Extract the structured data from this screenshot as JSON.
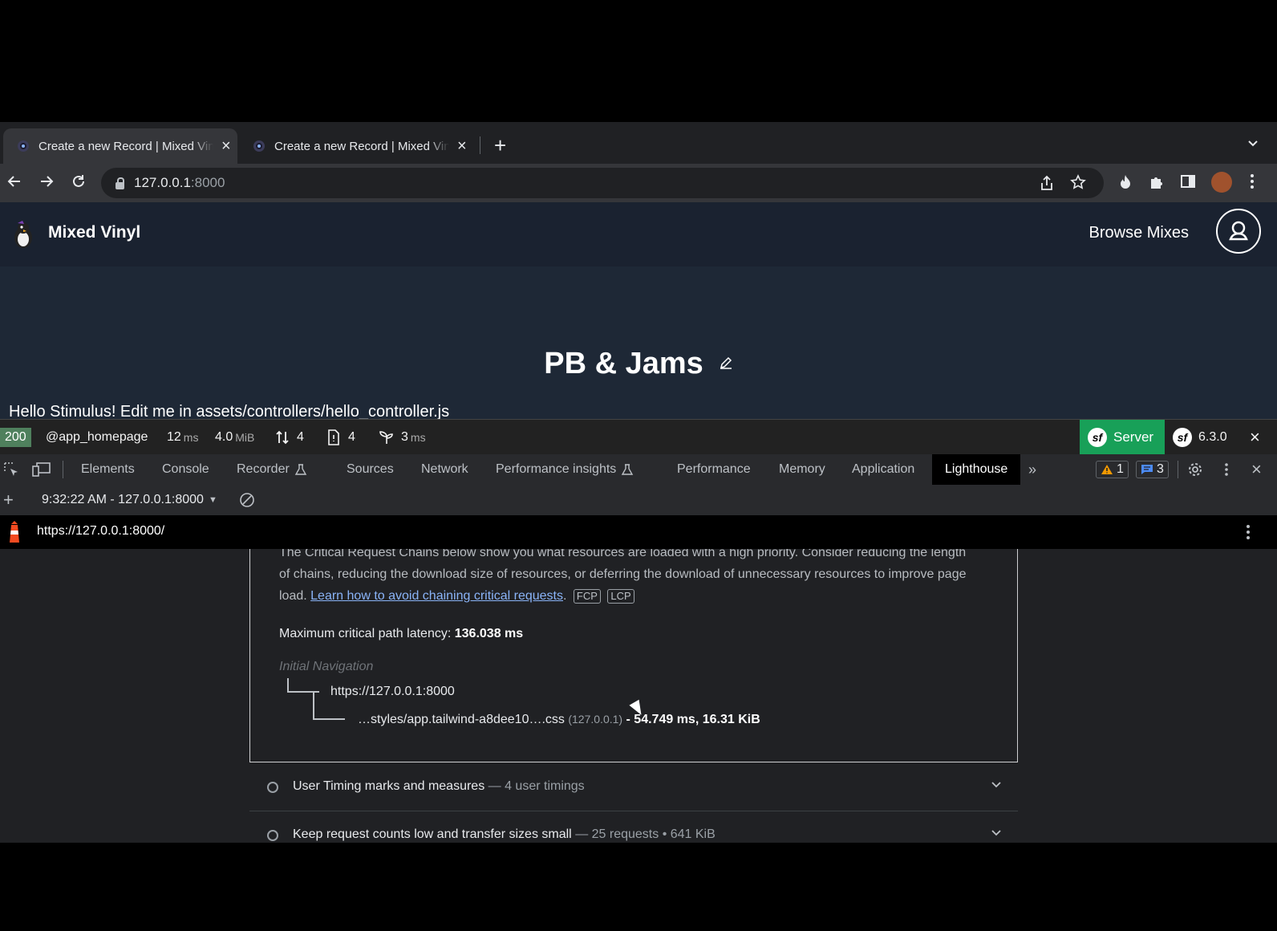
{
  "browser": {
    "tabs": [
      {
        "title": "Create a new Record | Mixed Vinyl",
        "active": true
      },
      {
        "title": "Create a new Record | Mixed Vinyl",
        "active": false
      }
    ],
    "new_tab_icon": "plus-icon",
    "tab_menu_icon": "chevron-down-icon",
    "url_host": "127.0.0.1",
    "url_port": ":8000",
    "nav_icons": [
      "back-arrow-icon",
      "forward-arrow-icon",
      "reload-icon"
    ],
    "toolbar_icons": [
      "share-icon",
      "star-icon",
      "flame-icon",
      "puzzle-icon",
      "sidepanel-icon",
      "profile-avatar",
      "kebab-menu-icon"
    ]
  },
  "site": {
    "brand": "Mixed Vinyl",
    "nav_link": "Browse Mixes",
    "page_title": "PB & Jams",
    "hello_text": "Hello Stimulus! Edit me in assets/controllers/hello_controller.js"
  },
  "symfony_toolbar": {
    "status_code": "200",
    "route": "@app_homepage",
    "time_value": "12",
    "time_unit": "ms",
    "memory_value": "4.0",
    "memory_unit": "MiB",
    "requests": "4",
    "files": "4",
    "twig_value": "3",
    "twig_unit": "ms",
    "server_label": "Server",
    "version": "6.3.0",
    "accent_color": "#18a058"
  },
  "devtools": {
    "tabs": [
      "Elements",
      "Console",
      "Recorder",
      "Sources",
      "Network",
      "Performance insights",
      "Performance",
      "Memory",
      "Application",
      "Lighthouse"
    ],
    "active_tab": "Lighthouse",
    "warnings_count": "1",
    "messages_count": "3",
    "report_selector": "9:32:22 AM - 127.0.0.1:8000",
    "report_url": "https://127.0.0.1:8000/"
  },
  "report": {
    "description_line1": "The Critical Request Chains below show you what resources are loaded with a high priority. Consider reducing the length",
    "description_line2": "of chains, reducing the download size of resources, or deferring the download of unnecessary resources to improve page",
    "description_line3_prefix": "load.",
    "learn_link": "Learn how to avoid chaining critical requests",
    "tag_fcp": "FCP",
    "tag_lcp": "LCP",
    "latency_label": "Maximum critical path latency:",
    "latency_value": "136.038 ms",
    "initial_navigation": "Initial Navigation",
    "chain_root": "https://127.0.0.1:8000",
    "chain_child_file": "…styles/app.tailwind-a8dee10….css",
    "chain_child_host": "(127.0.0.1)",
    "chain_child_stats": "- 54.749 ms, 16.31 KiB",
    "audits": [
      {
        "title": "User Timing marks and measures",
        "detail": "— 4 user timings"
      },
      {
        "title": "Keep request counts low and transfer sizes small",
        "detail": "— 25 requests • 641 KiB"
      }
    ]
  }
}
